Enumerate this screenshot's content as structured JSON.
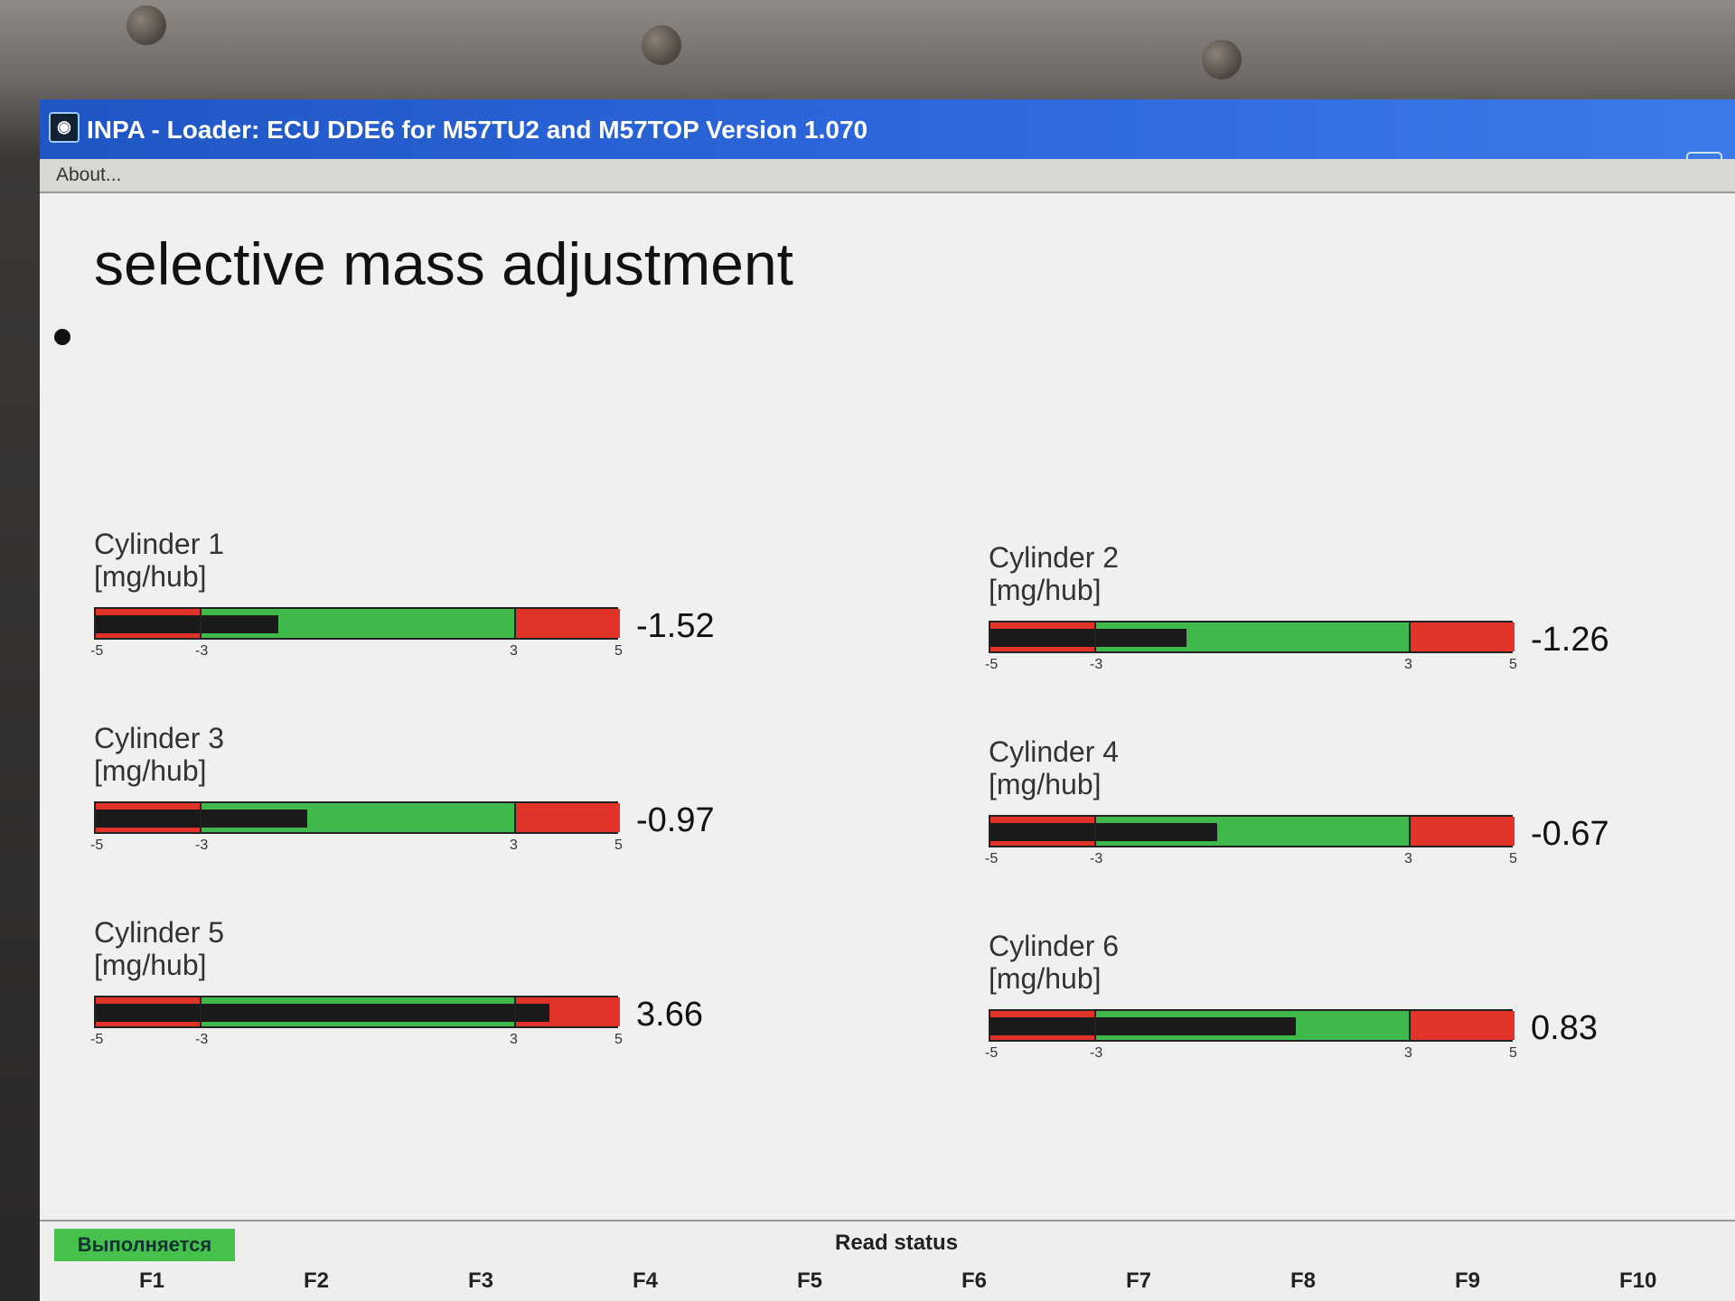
{
  "window": {
    "title": "INPA - Loader:  ECU DDE6 for M57TU2 and M57TOP Version 1.070",
    "menu": [
      "About..."
    ]
  },
  "page": {
    "title": "selective mass adjustment"
  },
  "cylinders": [
    {
      "name": "Cylinder 1",
      "unit": "[mg/hub]",
      "value": "-1.52",
      "level": -1.52
    },
    {
      "name": "Cylinder 2",
      "unit": "[mg/hub]",
      "value": "-1.26",
      "level": -1.26
    },
    {
      "name": "Cylinder 3",
      "unit": "[mg/hub]",
      "value": "-0.97",
      "level": -0.97
    },
    {
      "name": "Cylinder 4",
      "unit": "[mg/hub]",
      "value": "-0.67",
      "level": -0.67
    },
    {
      "name": "Cylinder 5",
      "unit": "[mg/hub]",
      "value": "3.66",
      "level": 3.66
    },
    {
      "name": "Cylinder 6",
      "unit": "[mg/hub]",
      "value": "0.83",
      "level": 0.83
    }
  ],
  "scale": {
    "min": -5,
    "warn_low": -3,
    "warn_high": 3,
    "max": 5,
    "labels": [
      "-5",
      "-3",
      "3",
      "5"
    ]
  },
  "colors": {
    "ok": "#3fb94a",
    "warn": "#e23328",
    "fill": "#1a1a1a",
    "title_bar": "#2f6ae0"
  },
  "status": {
    "running_label": "Выполняется",
    "read_status": "Read status",
    "fkeys": [
      "F1",
      "F2",
      "F3",
      "F4",
      "F5",
      "F6",
      "F7",
      "F8",
      "F9",
      "F10"
    ]
  }
}
